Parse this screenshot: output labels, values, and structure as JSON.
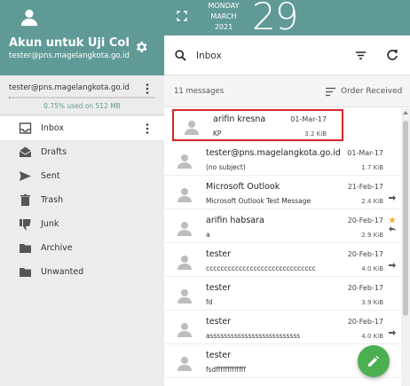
{
  "account": {
    "name": "Akun untuk Uji Cob...",
    "email": "tester@pns.magelangkota.go.id"
  },
  "quota": {
    "email": "tester@pns.magelangkota.go.id",
    "text": "0.75% used on 512 MB",
    "fraction": 0.0075
  },
  "folders": [
    {
      "label": "Inbox",
      "icon": "inbox-icon",
      "active": true
    },
    {
      "label": "Drafts",
      "icon": "drafts-icon"
    },
    {
      "label": "Sent",
      "icon": "sent-icon"
    },
    {
      "label": "Trash",
      "icon": "trash-icon"
    },
    {
      "label": "Junk",
      "icon": "junk-icon"
    },
    {
      "label": "Archive",
      "icon": "folder-icon"
    },
    {
      "label": "Unwanted",
      "icon": "folder-icon"
    }
  ],
  "date": {
    "weekday": "MONDAY",
    "month": "MARCH",
    "year": "2021",
    "day": "29"
  },
  "search": {
    "label": "Inbox"
  },
  "list": {
    "count": "11 messages",
    "order": "Order Received"
  },
  "messages": [
    {
      "from": "arifin kresna",
      "subject": "KP",
      "date": "01-Mar-17",
      "size": "3.2 KiB"
    },
    {
      "from": "tester@pns.magelangkota.go.id",
      "subject": "(no subject)",
      "date": "01-Mar-17",
      "size": "1.7 KiB"
    },
    {
      "from": "Microsoft Outlook",
      "subject": "Microsoft Outlook Test Message",
      "date": "21-Feb-17",
      "size": "2.4 KiB"
    },
    {
      "from": "arifin habsara",
      "subject": "a",
      "date": "20-Feb-17",
      "size": "2.9 KiB"
    },
    {
      "from": "tester",
      "subject": "cccccccccccccccccccccccccccccc",
      "date": "20-Feb-17",
      "size": "4.0 KiB"
    },
    {
      "from": "tester",
      "subject": "fd",
      "date": "20-Feb-17",
      "size": "3.9 KiB"
    },
    {
      "from": "tester",
      "subject": "assssssssssssssssssssssssss",
      "date": "20-Feb-17",
      "size": "4.0 KiB"
    },
    {
      "from": "tester",
      "subject": "fsdfffffffffffff",
      "date": "20-",
      "size": ""
    }
  ],
  "colors": {
    "accent": "#5f9a96",
    "fab": "#4caf50",
    "highlight": "#d9262a",
    "star": "#f2b01e"
  }
}
